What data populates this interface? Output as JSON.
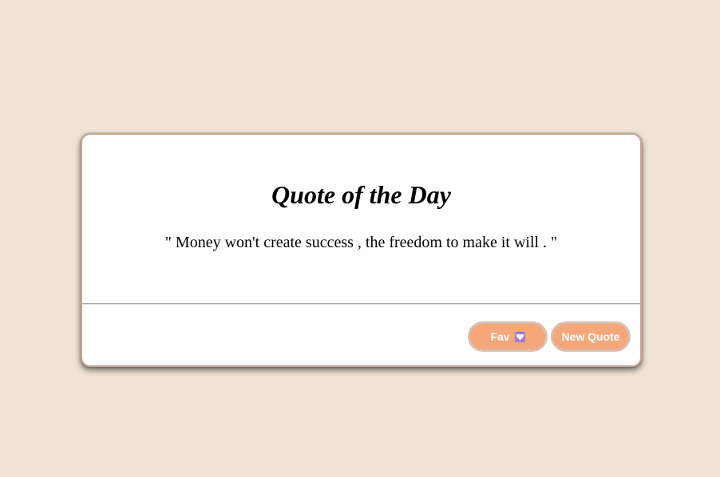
{
  "card": {
    "title": "Quote of the Day",
    "quote": "\" Money won't create success , the freedom to make it will . \""
  },
  "buttons": {
    "fav_label": "Fav",
    "fav_icon": "heart-icon",
    "new_quote_label": "New Quote"
  },
  "colors": {
    "background": "#f0e2d4",
    "card": "#ffffff",
    "button": "#f6a77a",
    "button_border": "#d8bfb0",
    "heart_badge": "#9d7ad8"
  }
}
